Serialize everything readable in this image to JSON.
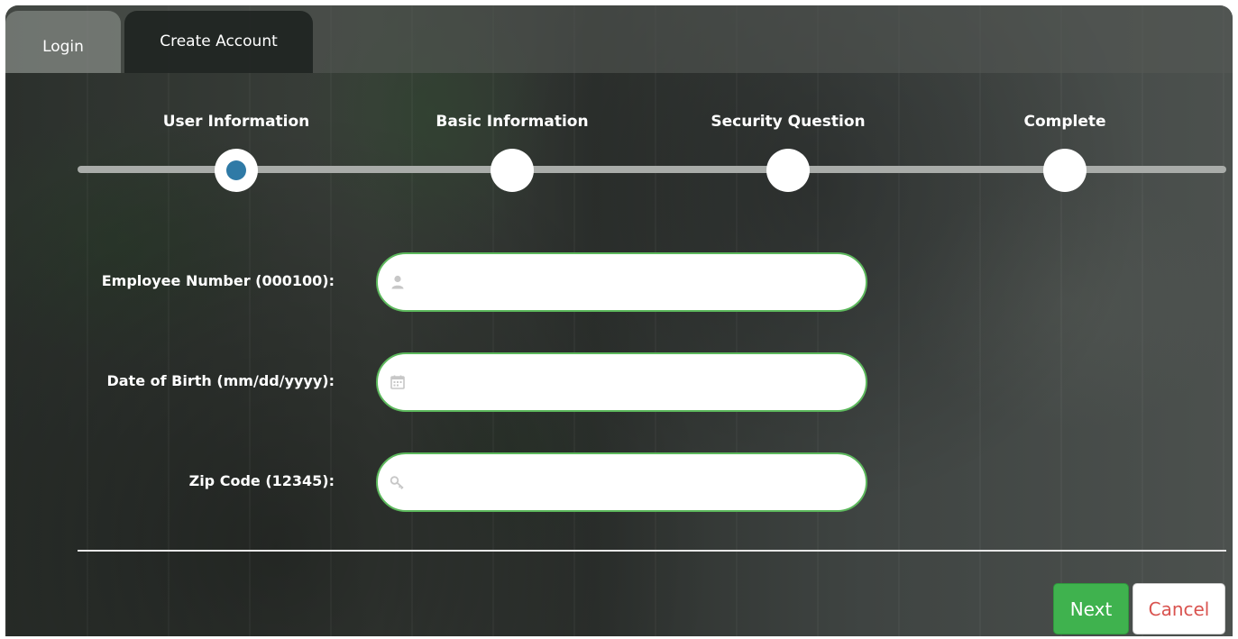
{
  "tabs": [
    {
      "label": "Login",
      "active": false
    },
    {
      "label": "Create Account",
      "active": true
    }
  ],
  "steps": [
    {
      "label": "User Information",
      "current": true
    },
    {
      "label": "Basic Information",
      "current": false
    },
    {
      "label": "Security Question",
      "current": false
    },
    {
      "label": "Complete",
      "current": false
    }
  ],
  "fields": [
    {
      "label": "Employee Number (000100):",
      "icon": "user-icon",
      "value": "",
      "placeholder": ""
    },
    {
      "label": "Date of Birth (mm/dd/yyyy):",
      "icon": "calendar-icon",
      "value": "",
      "placeholder": ""
    },
    {
      "label": "Zip Code (12345):",
      "icon": "key-icon",
      "value": "",
      "placeholder": ""
    }
  ],
  "buttons": {
    "next": "Next",
    "cancel": "Cancel"
  },
  "colors": {
    "primary": "#3fb24e",
    "cancel_text": "#d9534f",
    "step_active": "#2f7aa6",
    "field_border": "#5cb85c"
  }
}
